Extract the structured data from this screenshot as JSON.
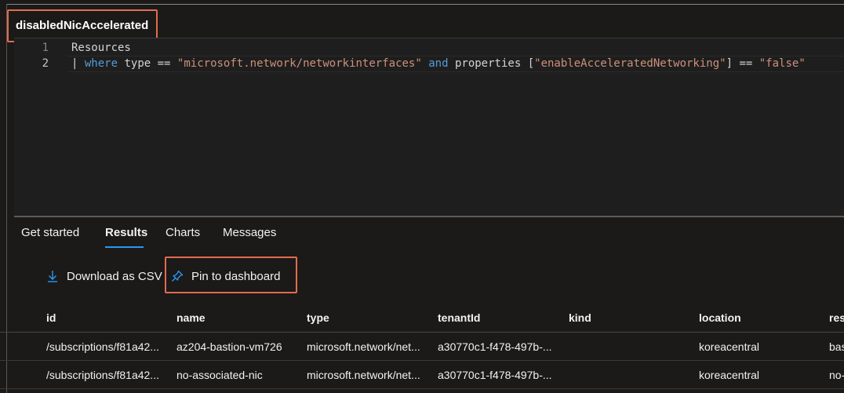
{
  "query_tab": {
    "title": "disabledNicAccelerated"
  },
  "editor": {
    "line_numbers": [
      "1",
      "2"
    ],
    "line1": {
      "text": "Resources"
    },
    "line2": {
      "pipe": "|",
      "where": "where",
      "type": "type",
      "eq1": "==",
      "str1": "\"microsoft.network/networkinterfaces\"",
      "and": "and",
      "properties": "properties",
      "bracket_open": "[",
      "str2": "\"enableAcceleratedNetworking\"",
      "bracket_close": "]",
      "eq2": "==",
      "str3": "\"false\""
    }
  },
  "results_tabs": [
    {
      "label": "Get started",
      "active": false
    },
    {
      "label": "Results",
      "active": true
    },
    {
      "label": "Charts",
      "active": false
    },
    {
      "label": "Messages",
      "active": false
    }
  ],
  "toolbar": {
    "download_label": "Download as CSV",
    "download_icon": "download-icon",
    "pin_label": "Pin to dashboard",
    "pin_icon": "pin-icon"
  },
  "table": {
    "headers": [
      "id",
      "name",
      "type",
      "tenantId",
      "kind",
      "location",
      "res"
    ],
    "rows": [
      [
        "/subscriptions/f81a42...",
        "az204-bastion-vm726",
        "microsoft.network/net...",
        "a30770c1-f478-497b-...",
        "",
        "koreacentral",
        "bas"
      ],
      [
        "/subscriptions/f81a42...",
        "no-associated-nic",
        "microsoft.network/net...",
        "a30770c1-f478-497b-...",
        "",
        "koreacentral",
        "no-"
      ]
    ]
  },
  "colors": {
    "accent": "#2899f5",
    "highlight": "#e26b4f",
    "keyword": "#569cd6",
    "string": "#ce9178"
  }
}
